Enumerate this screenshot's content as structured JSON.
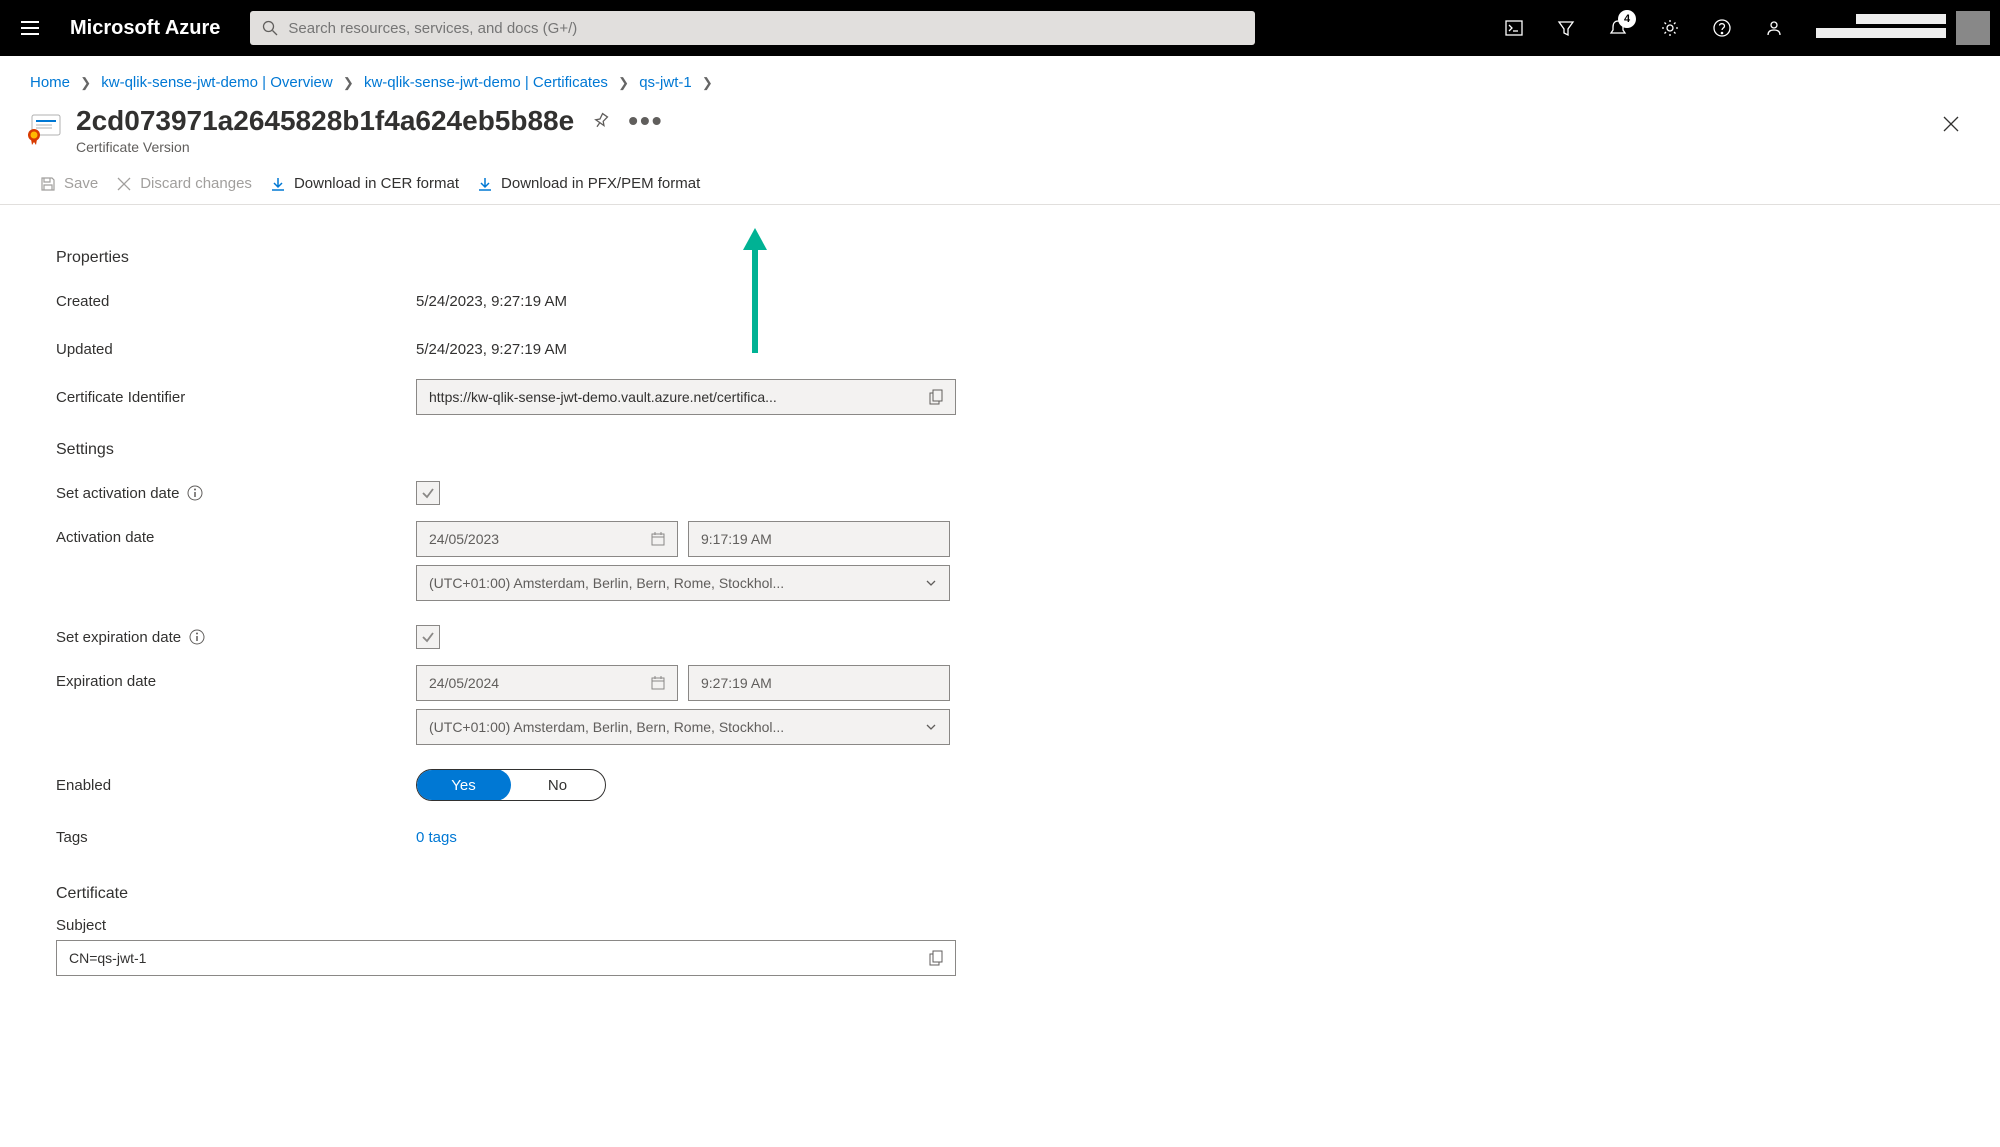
{
  "topbar": {
    "brand": "Microsoft Azure",
    "search_placeholder": "Search resources, services, and docs (G+/)",
    "notification_count": "4"
  },
  "breadcrumb": {
    "items": [
      {
        "label": "Home"
      },
      {
        "label": "kw-qlik-sense-jwt-demo | Overview"
      },
      {
        "label": "kw-qlik-sense-jwt-demo | Certificates"
      },
      {
        "label": "qs-jwt-1"
      }
    ]
  },
  "header": {
    "title": "2cd073971a2645828b1f4a624eb5b88e",
    "subtitle": "Certificate Version"
  },
  "toolbar": {
    "save": "Save",
    "discard": "Discard changes",
    "download_cer": "Download in CER format",
    "download_pfx": "Download in PFX/PEM format"
  },
  "sections": {
    "properties": "Properties",
    "settings": "Settings",
    "certificate": "Certificate"
  },
  "properties": {
    "created_label": "Created",
    "created_value": "5/24/2023, 9:27:19 AM",
    "updated_label": "Updated",
    "updated_value": "5/24/2023, 9:27:19 AM",
    "identifier_label": "Certificate Identifier",
    "identifier_value": "https://kw-qlik-sense-jwt-demo.vault.azure.net/certifica..."
  },
  "settings": {
    "set_activation_label": "Set activation date",
    "activation_date_label": "Activation date",
    "activation_date": "24/05/2023",
    "activation_time": "9:17:19 AM",
    "activation_tz": "(UTC+01:00) Amsterdam, Berlin, Bern, Rome, Stockhol...",
    "set_expiration_label": "Set expiration date",
    "expiration_date_label": "Expiration date",
    "expiration_date": "24/05/2024",
    "expiration_time": "9:27:19 AM",
    "expiration_tz": "(UTC+01:00) Amsterdam, Berlin, Bern, Rome, Stockhol...",
    "enabled_label": "Enabled",
    "enabled_yes": "Yes",
    "enabled_no": "No",
    "tags_label": "Tags",
    "tags_value": "0 tags"
  },
  "certificate": {
    "subject_label": "Subject",
    "subject_value": "CN=qs-jwt-1"
  }
}
